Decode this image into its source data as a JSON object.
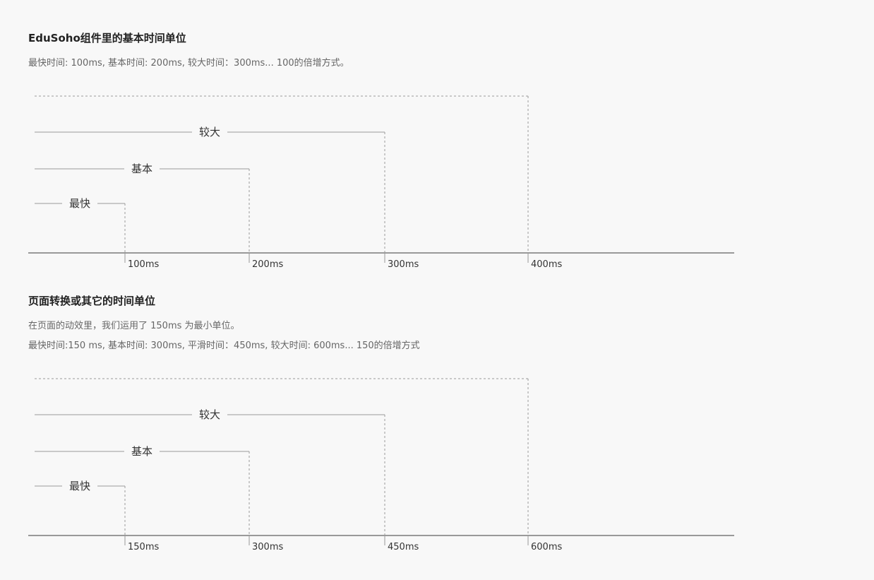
{
  "sections": [
    {
      "title": "EduSoho组件里的基本时间单位",
      "desc_lines": [
        "最快时间: 100ms, 基本时间: 200ms, 较大时间：300ms...  100的倍增方式。"
      ],
      "chart_data": {
        "type": "timeline-diagram",
        "ticks": [
          "100ms",
          "200ms",
          "300ms",
          "400ms"
        ],
        "tiers": [
          {
            "label": "最快",
            "tick_index": 0
          },
          {
            "label": "基本",
            "tick_index": 1
          },
          {
            "label": "较大",
            "tick_index": 2
          }
        ],
        "dashed_boundary_tick_index": 3
      }
    },
    {
      "title": "页面转换或其它的时间单位",
      "desc_lines": [
        "在页面的动效里，我们运用了 150ms 为最小单位。",
        "最快时间:150 ms, 基本时间: 300ms, 平滑时间：450ms, 较大时间: 600ms...  150的倍增方式"
      ],
      "chart_data": {
        "type": "timeline-diagram",
        "ticks": [
          "150ms",
          "300ms",
          "450ms",
          "600ms"
        ],
        "tiers": [
          {
            "label": "最快",
            "tick_index": 0
          },
          {
            "label": "基本",
            "tick_index": 1
          },
          {
            "label": "较大",
            "tick_index": 2
          }
        ],
        "dashed_boundary_tick_index": 3
      }
    }
  ],
  "colors": {
    "background": "#f8f8f8",
    "title": "#222222",
    "description": "#666666",
    "axis": "#999999",
    "guide": "#9a9a9a",
    "label": "#333333"
  }
}
